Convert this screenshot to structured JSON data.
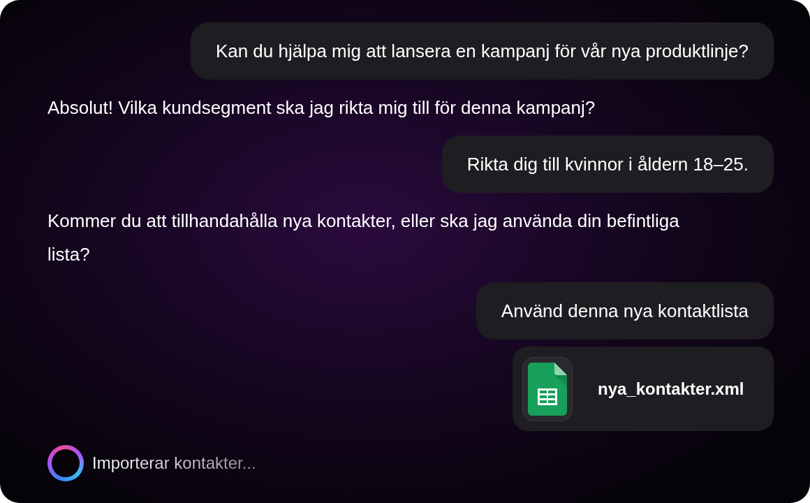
{
  "messages": [
    {
      "kind": "user",
      "text": "Kan du hjälpa mig att lansera en kampanj för vår nya produktlinje?"
    },
    {
      "kind": "assistant",
      "text": "Absolut! Vilka kundsegment ska jag rikta mig till för denna kampanj?"
    },
    {
      "kind": "user",
      "text": "Rikta dig till kvinnor i åldern 18–25."
    },
    {
      "kind": "assistant",
      "text": "Kommer du att tillhandahålla nya kontakter, eller ska jag använda din befintliga lista?"
    },
    {
      "kind": "user",
      "text": "Använd denna nya kontaktlista"
    },
    {
      "kind": "file",
      "name": "nya_kontakter.xml"
    }
  ],
  "status": {
    "text": "Importerar kontakter..."
  }
}
